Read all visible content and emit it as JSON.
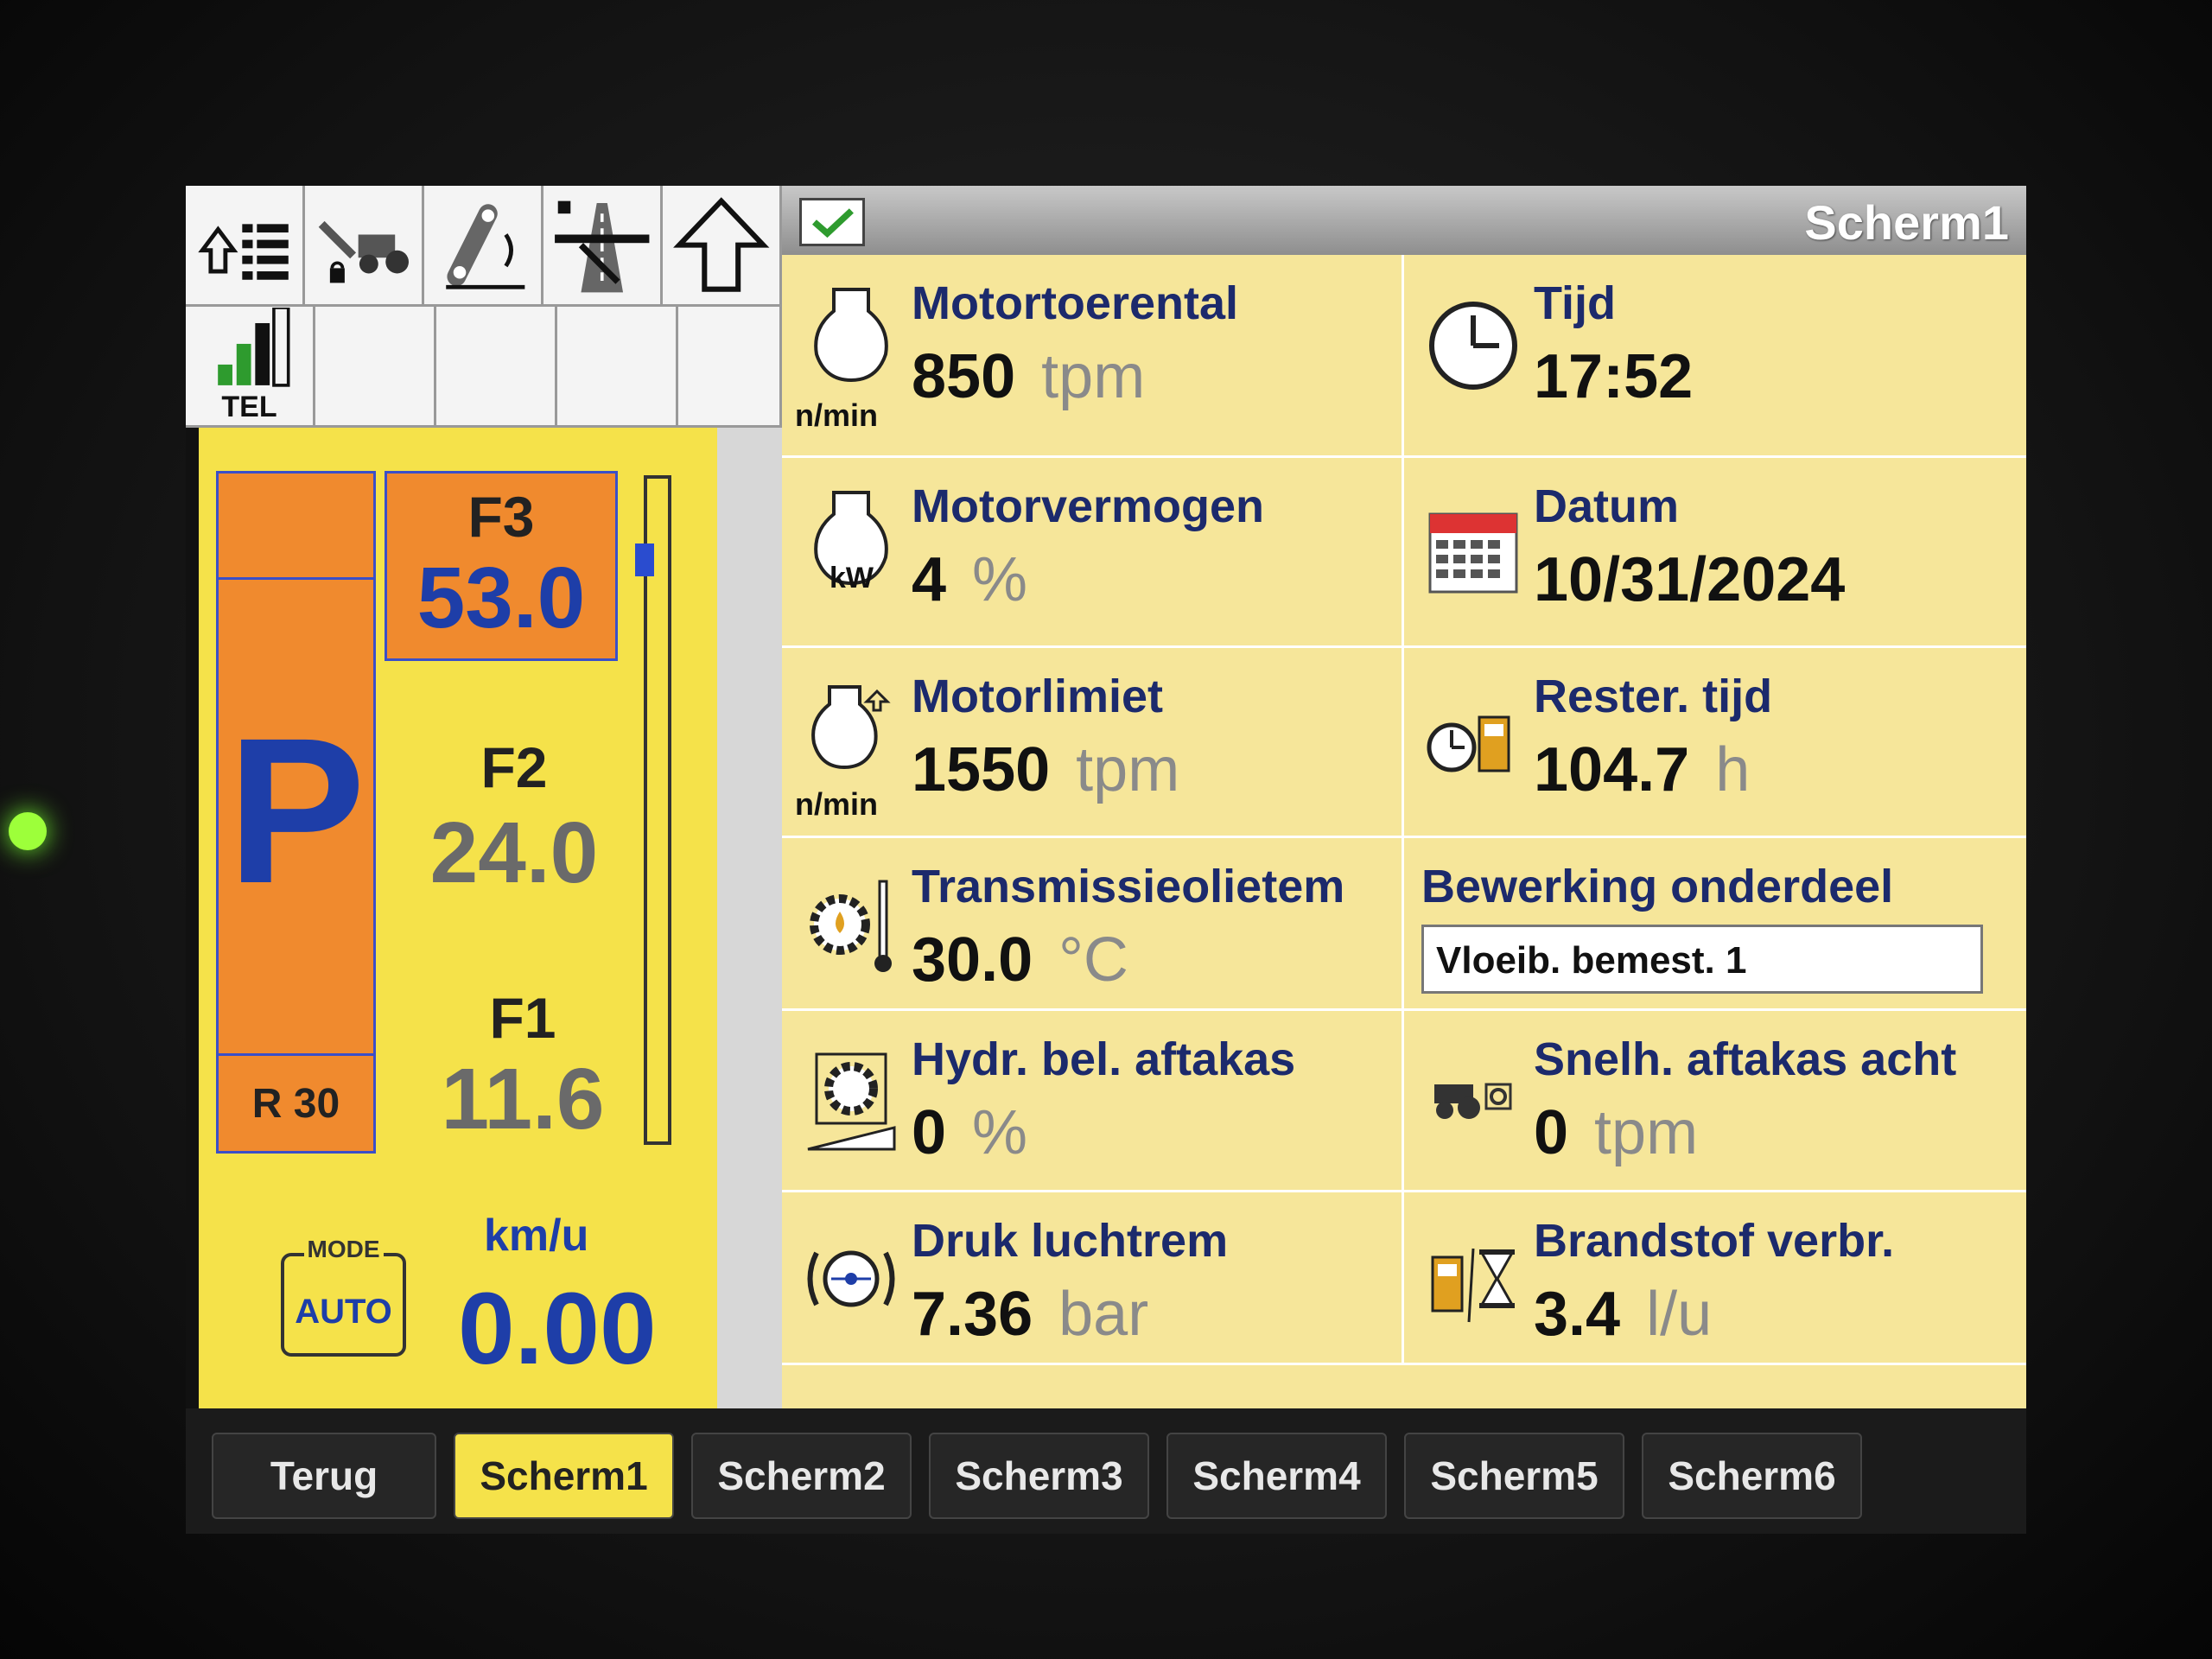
{
  "header": {
    "title": "Scherm1"
  },
  "left_panel": {
    "tel_label": "TEL",
    "park_letter": "P",
    "reverse_label": "R 30",
    "gears": [
      {
        "label": "F3",
        "value": "53.0"
      },
      {
        "label": "F2",
        "value": "24.0"
      },
      {
        "label": "F1",
        "value": "11.6"
      }
    ],
    "mode_label": "MODE",
    "mode_value": "AUTO",
    "speed_unit": "km/u",
    "speed_value": "0.00"
  },
  "cells": {
    "engine_speed": {
      "label": "Motortoerental",
      "value": "850",
      "unit": "tpm",
      "icon_caption": "n/min"
    },
    "time": {
      "label": "Tijd",
      "value": "17:52"
    },
    "engine_power": {
      "label": "Motorvermogen",
      "value": "4",
      "unit": "%",
      "icon_caption": "kW"
    },
    "date": {
      "label": "Datum",
      "value": "10/31/2024"
    },
    "engine_limit": {
      "label": "Motorlimiet",
      "value": "1550",
      "unit": "tpm",
      "icon_caption": "n/min"
    },
    "remaining_time": {
      "label": "Rester. tijd",
      "value": "104.7",
      "unit": "h"
    },
    "transmission_oil": {
      "label": "Transmissieolietem",
      "value": "30.0",
      "unit": "°C"
    },
    "work_section": {
      "label": "Bewerking onderdeel",
      "value": "Vloeib. bemest. 1"
    },
    "pto_load": {
      "label": "Hydr. bel. aftakas",
      "value": "0",
      "unit": "%"
    },
    "rear_pto_speed": {
      "label": "Snelh. aftakas acht",
      "value": "0",
      "unit": "tpm"
    },
    "air_brake": {
      "label": "Druk luchtrem",
      "value": "7.36",
      "unit": "bar"
    },
    "fuel_consumption": {
      "label": "Brandstof verbr.",
      "value": "3.4",
      "unit": "l/u"
    }
  },
  "tabs": [
    "Terug",
    "Scherm1",
    "Scherm2",
    "Scherm3",
    "Scherm4",
    "Scherm5",
    "Scherm6"
  ],
  "active_tab": "Scherm1",
  "icons": [
    "menu-up-icon",
    "tractor-lock-icon",
    "linkage-icon",
    "road-lock-icon",
    "arrow-up-icon",
    "signal-bars-icon",
    "engine-icon",
    "clock-icon",
    "calendar-icon",
    "fuel-timer-icon",
    "gear-thermometer-icon",
    "pto-gear-icon",
    "tractor-pto-icon",
    "air-brake-icon",
    "fuel-hourglass-icon",
    "checkmark-icon"
  ],
  "colors": {
    "panel_yellow": "#f5e24a",
    "gear_orange": "#f08a2e",
    "accent_blue": "#1e3ea8",
    "data_bg": "#f6e69a"
  }
}
